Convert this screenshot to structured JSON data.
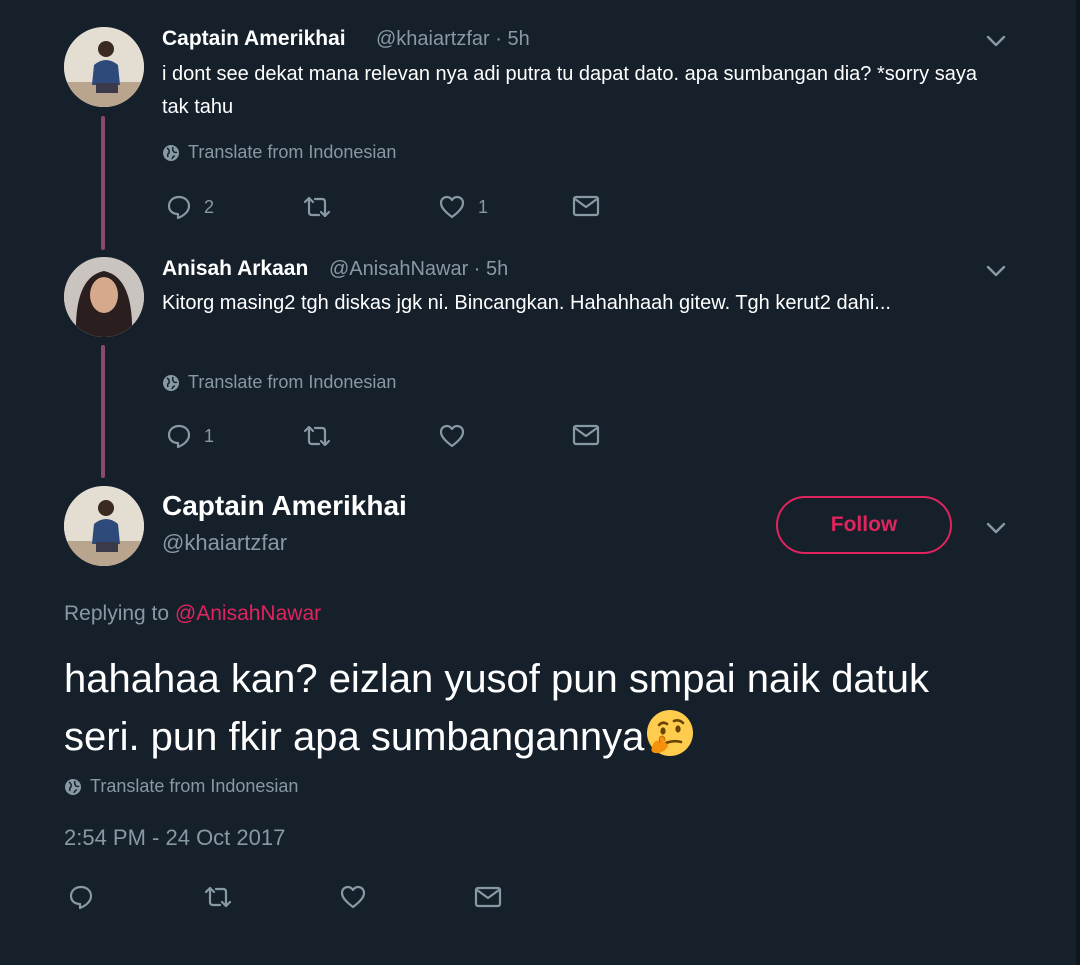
{
  "tweets": [
    {
      "name": "Captain Amerikhai",
      "handle_time": "@khaiartzfar · 5h",
      "text": "i dont see dekat mana relevan nya adi putra tu dapat dato. apa sumbangan dia? *sorry saya tak tahu",
      "translate": "Translate from Indonesian",
      "reply_count": "2",
      "retweet_count": "",
      "like_count": "1"
    },
    {
      "name": "Anisah Arkaan",
      "handle_time": "@AnisahNawar · 5h",
      "text": "Kitorg masing2 tgh diskas jgk ni. Bincangkan. Hahahhaah gitew. Tgh kerut2 dahi...",
      "translate": "Translate from Indonesian",
      "reply_count": "1",
      "retweet_count": "",
      "like_count": ""
    }
  ],
  "main": {
    "name": "Captain Amerikhai",
    "handle": "@khaiartzfar",
    "follow_label": "Follow",
    "replying_prefix": "Replying to",
    "replying_to": "@AnisahNawar",
    "text": "hahahaa kan? eizlan yusof pun smpai naik datuk seri. pun fkir apa sumbangannya",
    "emoji": "thinking-face",
    "translate": "Translate from Indonesian",
    "timestamp": "2:54 PM - 24 Oct 2017"
  },
  "colors": {
    "background": "#15202b",
    "accent": "#e0245e",
    "muted": "#8899a6",
    "thread_line": "#8a4b6b"
  }
}
